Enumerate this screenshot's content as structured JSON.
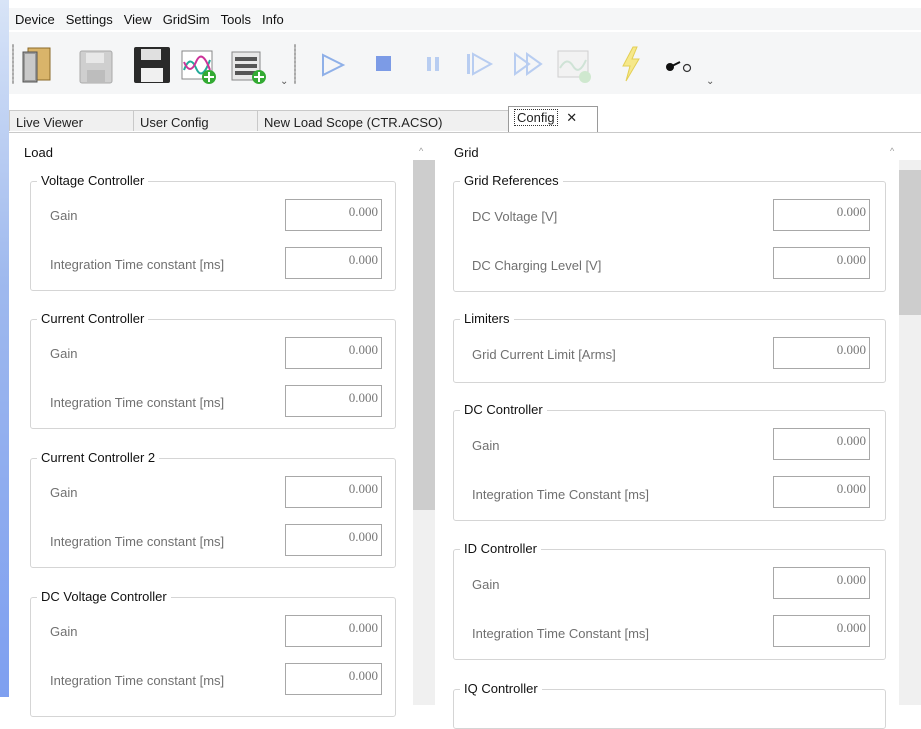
{
  "menu": [
    "Device",
    "Settings",
    "View",
    "GridSim",
    "Tools",
    "Info"
  ],
  "toolbar": {
    "icons": [
      "open-icon",
      "save-icon",
      "save-all-icon",
      "waveform-add-icon",
      "list-add-icon",
      "play-icon",
      "stop-icon",
      "pause-icon",
      "step-icon",
      "fast-forward-icon",
      "chart-icon",
      "lightning-icon",
      "toggle-icon"
    ],
    "overflow": "⌄"
  },
  "tabs": [
    {
      "label": "Live Viewer"
    },
    {
      "label": "User Config"
    },
    {
      "label": "New Load Scope (CTR.ACSO)"
    },
    {
      "label": "Config",
      "close": "✕"
    }
  ],
  "left": {
    "title": "Load",
    "groups": [
      {
        "title": "Voltage Controller",
        "fields": [
          {
            "label": "Gain",
            "value": "0.000"
          },
          {
            "label": "Integration Time constant [ms]",
            "value": "0.000"
          }
        ]
      },
      {
        "title": "Current Controller",
        "fields": [
          {
            "label": "Gain",
            "value": "0.000"
          },
          {
            "label": "Integration Time constant [ms]",
            "value": "0.000"
          }
        ]
      },
      {
        "title": "Current Controller 2",
        "fields": [
          {
            "label": "Gain",
            "value": "0.000"
          },
          {
            "label": "Integration Time constant [ms]",
            "value": "0.000"
          }
        ]
      },
      {
        "title": "DC Voltage Controller",
        "fields": [
          {
            "label": "Gain",
            "value": "0.000"
          },
          {
            "label": "Integration Time constant [ms]",
            "value": "0.000"
          }
        ]
      }
    ]
  },
  "right": {
    "title": "Grid",
    "groups": [
      {
        "title": "Grid References",
        "fields": [
          {
            "label": "DC Voltage [V]",
            "value": "0.000"
          },
          {
            "label": "DC Charging Level [V]",
            "value": "0.000"
          }
        ]
      },
      {
        "title": "Limiters",
        "fields": [
          {
            "label": "Grid Current Limit [Arms]",
            "value": "0.000"
          }
        ]
      },
      {
        "title": "DC Controller",
        "fields": [
          {
            "label": "Gain",
            "value": "0.000"
          },
          {
            "label": "Integration Time Constant [ms]",
            "value": "0.000"
          }
        ]
      },
      {
        "title": "ID Controller",
        "fields": [
          {
            "label": "Gain",
            "value": "0.000"
          },
          {
            "label": "Integration Time Constant [ms]",
            "value": "0.000"
          }
        ]
      },
      {
        "title": "IQ Controller",
        "fields": []
      }
    ]
  },
  "scroll": {
    "up_arrow": "^"
  }
}
